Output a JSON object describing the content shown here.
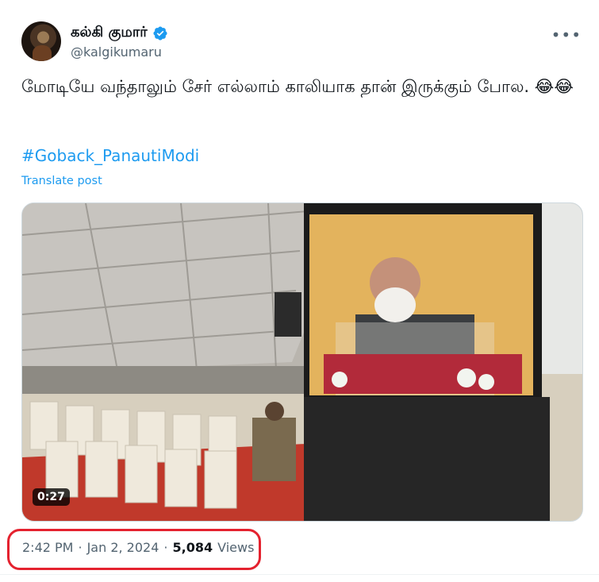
{
  "author": {
    "display_name": "கல்கி குமார்",
    "handle": "@kalgikumaru",
    "verified": true
  },
  "tweet": {
    "text": "மோடியே வந்தாலும் சேர் எல்லாம் காலியாக தான் இருக்கும் போல. 😂😂",
    "hashtag": "#Goback_PanautiModi",
    "translate_label": "Translate post"
  },
  "media": {
    "type": "video",
    "duration": "0:27"
  },
  "meta": {
    "time": "2:42 PM",
    "date": "Jan 2, 2024",
    "views_count": "5,084",
    "views_label": "Views"
  },
  "colors": {
    "link": "#1d9bf0",
    "verified": "#1d9bf0",
    "highlight": "#e4222f"
  },
  "icons": {
    "more": "more-horizontal-icon",
    "verified": "verified-badge-icon"
  }
}
